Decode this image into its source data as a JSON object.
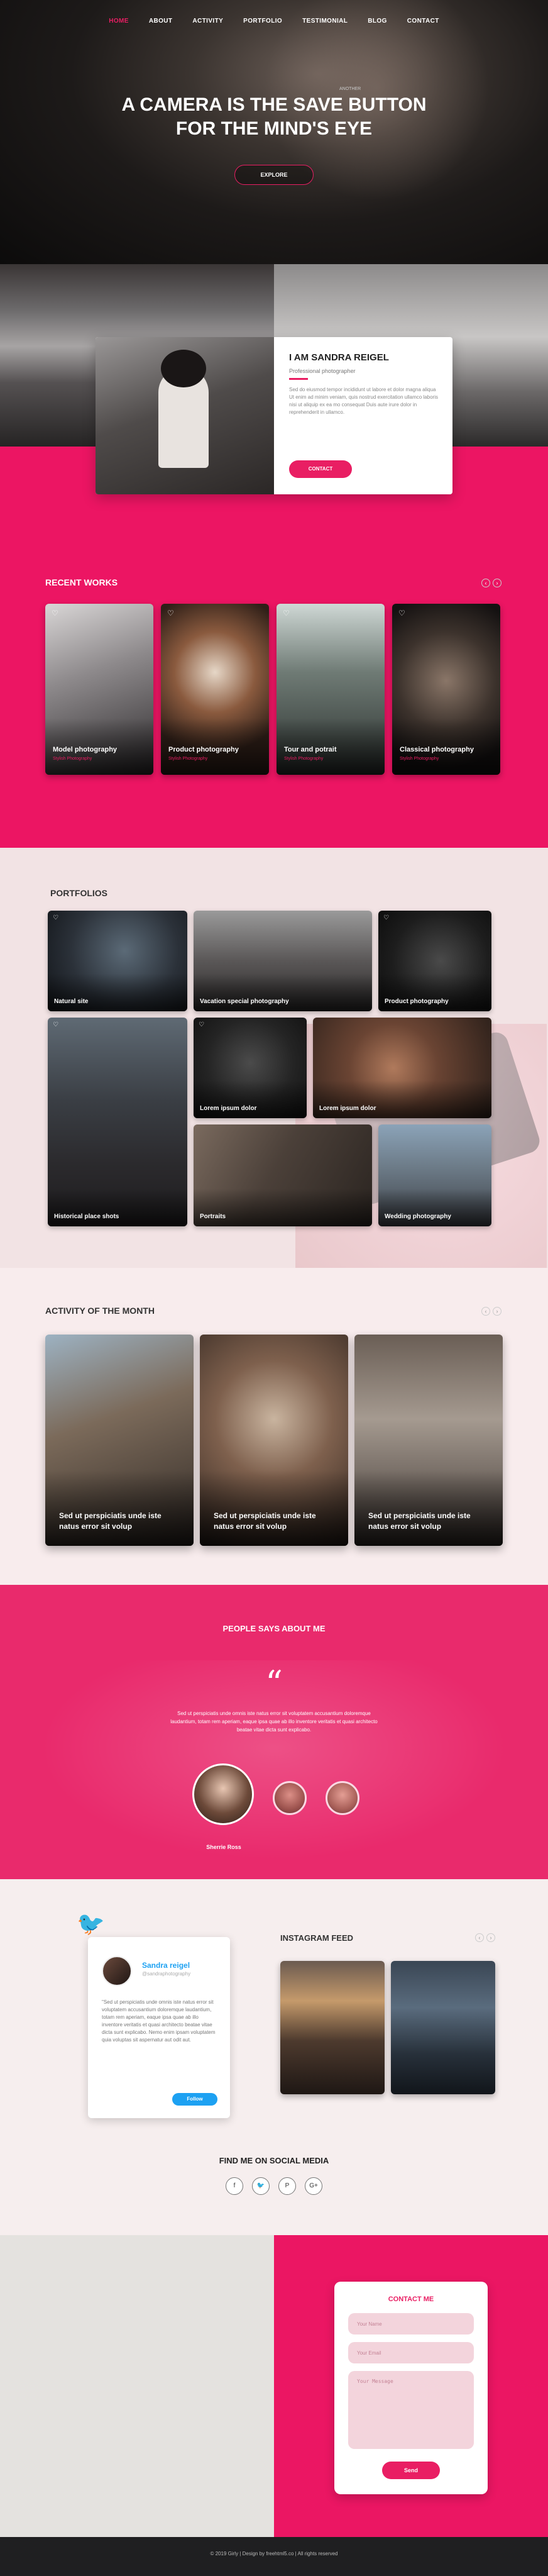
{
  "nav": {
    "items": [
      "HOME",
      "ABOUT",
      "ACTIVITY",
      "PORTFOLIO",
      "TESTIMONIAL",
      "BLOG",
      "CONTACT"
    ],
    "active": "HOME"
  },
  "hero": {
    "small_text": "ANOTHER",
    "title_line1": "A CAMERA IS THE SAVE BUTTON",
    "title_line2": "FOR THE MIND'S EYE",
    "cta": "EXPLORE"
  },
  "about": {
    "title": "I AM SANDRA REIGEL",
    "role": "Professional photographer",
    "text": "Sed do eiusmod tempor incididunt ut labore et dolor magna aliqua Ut enim ad minim veniam, quis nostrud exercitation ullamco laboris nisi ut aliquip ex ea mo consequat Duis aute irure dolor in reprehenderit in ullamco.",
    "cta": "CONTACT"
  },
  "recent_works": {
    "title": "RECENT WORKS",
    "items": [
      {
        "title": "Model photography",
        "sub": "Stylish Photography"
      },
      {
        "title": "Product photography",
        "sub": "Stylish Photography"
      },
      {
        "title": "Tour and potrait",
        "sub": "Stylish Photography"
      },
      {
        "title": "Classical photography",
        "sub": "Stylish Photography"
      }
    ]
  },
  "portfolios": {
    "title": "PORTFOLIOS",
    "items": [
      "Natural site",
      "Vacation special photography",
      "Product photography",
      "Historical place shots",
      "Lorem ipsum dolor",
      "Lorem ipsum dolor",
      "Portraits",
      "Wedding photography"
    ]
  },
  "activity": {
    "title": "ACTIVITY OF THE MONTH",
    "items": [
      "Sed ut perspiciatis unde iste natus error sit volup",
      "Sed ut perspiciatis unde iste natus error sit volup",
      "Sed ut perspiciatis unde iste natus error sit volup"
    ]
  },
  "testimonial": {
    "title": "PEOPLE SAYS ABOUT ME",
    "text": "Sed ut perspiciatis unde omnis iste natus error sit voluptatem accusantium doloremque laudantium, totam rem aperiam, eaque ipsa quae ab illo inventore veritatis et quasi architecto beatae vitae dicta sunt explicabo.",
    "name": "Sherrie Ross"
  },
  "twitter": {
    "name": "Sandra reigel",
    "handle": "@sandraphotography",
    "text": "\"Sed ut perspiciatis unde omnis iste natus error sit voluptatem accusantium doloremque laudantium, totam rem aperiam, eaque ipsa quae ab illo inventore veritatis et quasi architecto beatae vitae dicta sunt explicabo. Nemo enim ipsam voluptatem quia voluptas sit aspernatur aut odit aut.",
    "follow": "Follow"
  },
  "instagram": {
    "title": "INSTAGRAM FEED"
  },
  "find": {
    "title": "FIND ME ON SOCIAL MEDIA"
  },
  "contact": {
    "title": "CONTACT ME",
    "name_placeholder": "Your Name",
    "email_placeholder": "Your Email",
    "message_placeholder": "Your Message",
    "send": "Send"
  },
  "footer": {
    "text": "© 2019 Girly  |  Design by freehtml5.co  |  All rights reserved"
  },
  "colors": {
    "accent": "#e91e63",
    "twitter": "#1da1f2"
  }
}
